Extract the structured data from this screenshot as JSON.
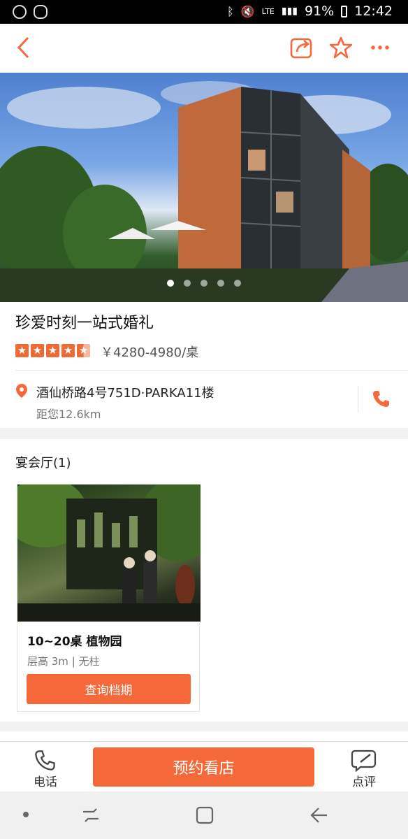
{
  "status_bar": {
    "left_icons": [
      "profile-icon",
      "talk-icon"
    ],
    "network": "LTE",
    "battery": "91%",
    "time": "12:42"
  },
  "header": {
    "back_icon": "back-icon",
    "share_icon": "share-icon",
    "favorite_icon": "star-outline-icon",
    "more_icon": "more-icon"
  },
  "gallery": {
    "total_images": 5,
    "active_index": 0
  },
  "venue": {
    "name": "珍爱时刻一站式婚礼",
    "rating": 4.5,
    "rating_max": 5,
    "price": "￥4280-4980/桌",
    "address": "酒仙桥路4号751D·PARKA11楼",
    "distance": "距您12.6km"
  },
  "halls_section": {
    "title": "宴会厅(1)",
    "halls": [
      {
        "name": "10~20桌 植物园",
        "meta": "层高 3m | 无柱",
        "button_label": "查询档期"
      }
    ]
  },
  "action_bar": {
    "phone_label": "电话",
    "reserve_label": "预约看店",
    "review_label": "点评"
  },
  "colors": {
    "accent": "#f5683a",
    "star": "#f06a35"
  }
}
